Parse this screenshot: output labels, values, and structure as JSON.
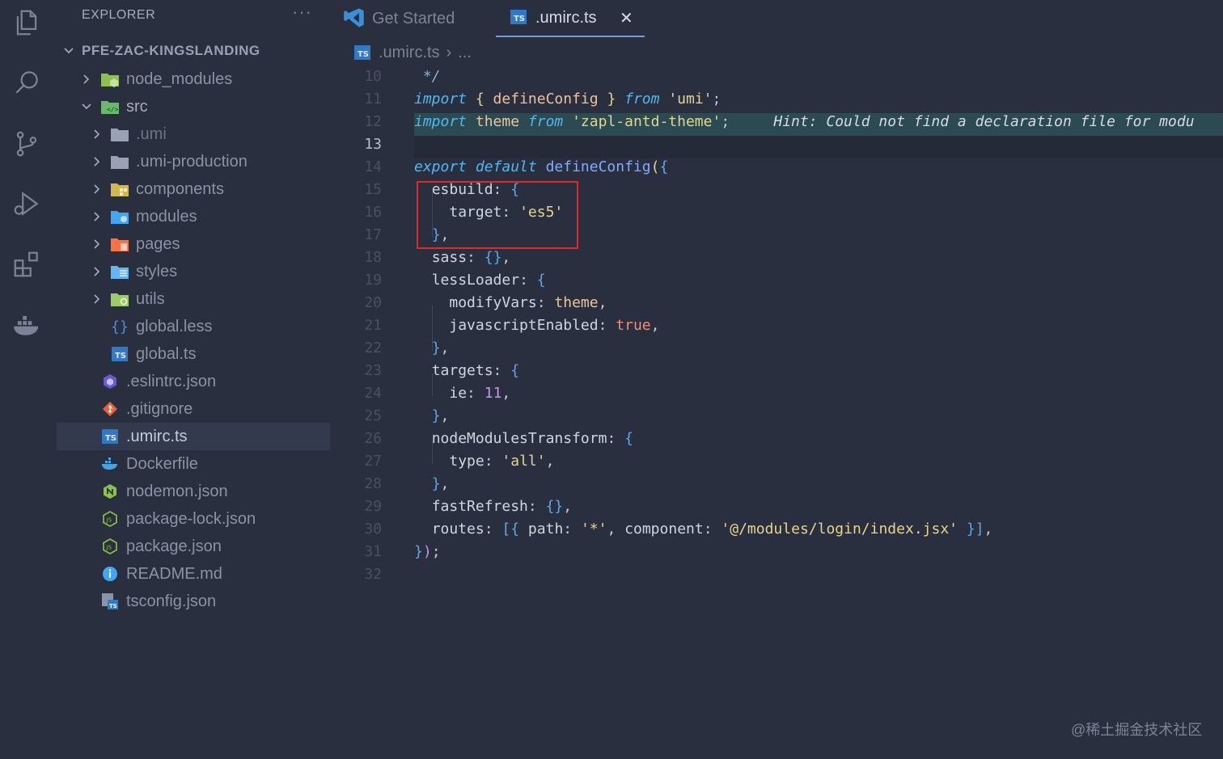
{
  "sidebar": {
    "title": "EXPLORER",
    "more_label": "···",
    "root": "PFE-ZAC-KINGSLANDING",
    "items": [
      {
        "label": "node_modules"
      },
      {
        "label": "src"
      },
      {
        "label": ".umi"
      },
      {
        "label": ".umi-production"
      },
      {
        "label": "components"
      },
      {
        "label": "modules"
      },
      {
        "label": "pages"
      },
      {
        "label": "styles"
      },
      {
        "label": "utils"
      },
      {
        "label": "global.less",
        "icon_text": "{}"
      },
      {
        "label": "global.ts",
        "icon_text": "TS"
      },
      {
        "label": ".eslintrc.json"
      },
      {
        "label": ".gitignore"
      },
      {
        "label": ".umirc.ts",
        "icon_text": "TS"
      },
      {
        "label": "Dockerfile"
      },
      {
        "label": "nodemon.json"
      },
      {
        "label": "package-lock.json"
      },
      {
        "label": "package.json"
      },
      {
        "label": "README.md"
      },
      {
        "label": "tsconfig.json"
      }
    ]
  },
  "tabs": [
    {
      "label": "Get Started"
    },
    {
      "label": ".umirc.ts",
      "icon_text": "TS",
      "close": "✕"
    }
  ],
  "breadcrumb": {
    "file": ".umirc.ts",
    "sep": "›",
    "more": "..."
  },
  "editor": {
    "line_numbers": [
      "10",
      "11",
      "12",
      "13",
      "14",
      "15",
      "16",
      "17",
      "18",
      "19",
      "20",
      "21",
      "22",
      "23",
      "24",
      "25",
      "26",
      "27",
      "28",
      "29",
      "30",
      "31",
      "32"
    ],
    "lines": {
      "l10": [
        "*/"
      ],
      "l11": [
        "import",
        " ",
        "{",
        " defineConfig ",
        "}",
        " ",
        "from",
        " ",
        "'umi'",
        ";"
      ],
      "l12": [
        "import",
        " theme ",
        "from",
        " ",
        "'zapl-antd-theme'",
        ";",
        "     Hint: Could not find a declaration file for modu"
      ],
      "l14": [
        "export default",
        " ",
        "defineConfig",
        "(",
        "{"
      ],
      "l15": [
        "esbuild",
        ": ",
        "{"
      ],
      "l16": [
        "target",
        ": ",
        "'es5'"
      ],
      "l17": [
        "}",
        ","
      ],
      "l18": [
        "sass",
        ": ",
        "{}",
        ","
      ],
      "l19": [
        "lessLoader",
        ": ",
        "{"
      ],
      "l20": [
        "modifyVars",
        ": ",
        "theme",
        ","
      ],
      "l21": [
        "javascriptEnabled",
        ": ",
        "true",
        ","
      ],
      "l22": [
        "}",
        ","
      ],
      "l23": [
        "targets",
        ": ",
        "{"
      ],
      "l24": [
        "ie",
        ": ",
        "11",
        ","
      ],
      "l25": [
        "}",
        ","
      ],
      "l26": [
        "nodeModulesTransform",
        ": ",
        "{"
      ],
      "l27": [
        "type",
        ": ",
        "'all'",
        ","
      ],
      "l28": [
        "}",
        ","
      ],
      "l29": [
        "fastRefresh",
        ": ",
        "{}",
        ","
      ],
      "l30": [
        "routes",
        ": ",
        "[{",
        " path",
        ": ",
        "'*'",
        ", ",
        "component",
        ": ",
        "'@/modules/login/index.jsx'",
        " }]",
        ","
      ],
      "l31": [
        "}",
        ")",
        ";"
      ]
    }
  },
  "watermark": "@稀土掘金技术社区"
}
